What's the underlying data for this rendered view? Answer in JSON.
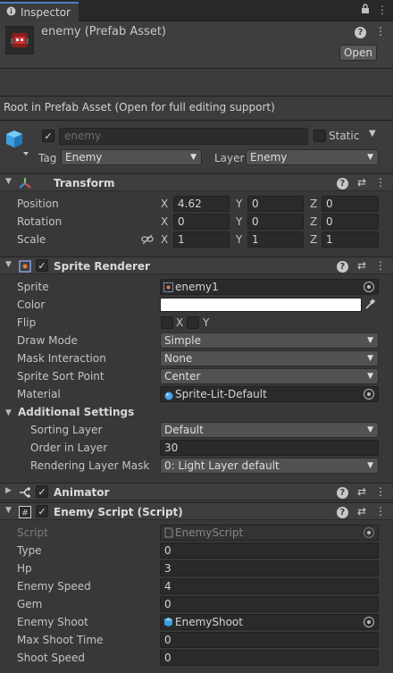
{
  "tab": {
    "title": "Inspector",
    "icon": "info-icon"
  },
  "header": {
    "asset_title": "enemy (Prefab Asset)",
    "open_label": "Open",
    "root_message": "Root in Prefab Asset (Open for full editing support)"
  },
  "gameobject": {
    "name": "enemy",
    "active": true,
    "static_label": "Static",
    "tag_label": "Tag",
    "tag_value": "Enemy",
    "layer_label": "Layer",
    "layer_value": "Enemy"
  },
  "transform": {
    "title": "Transform",
    "position_label": "Position",
    "rotation_label": "Rotation",
    "scale_label": "Scale",
    "position": {
      "x": "4.62",
      "y": "0",
      "z": "0"
    },
    "rotation": {
      "x": "0",
      "y": "0",
      "z": "0"
    },
    "scale": {
      "x": "1",
      "y": "1",
      "z": "1"
    },
    "axis_x": "X",
    "axis_y": "Y",
    "axis_z": "Z"
  },
  "sprite_renderer": {
    "title": "Sprite Renderer",
    "enabled": true,
    "sprite_label": "Sprite",
    "sprite_value": "enemy1",
    "color_label": "Color",
    "color_value": "#ffffff",
    "flip_label": "Flip",
    "flip_x": "X",
    "flip_y": "Y",
    "draw_mode_label": "Draw Mode",
    "draw_mode_value": "Simple",
    "mask_label": "Mask Interaction",
    "mask_value": "None",
    "sort_point_label": "Sprite Sort Point",
    "sort_point_value": "Center",
    "material_label": "Material",
    "material_value": "Sprite-Lit-Default",
    "additional_settings": "Additional Settings",
    "sorting_layer_label": "Sorting Layer",
    "sorting_layer_value": "Default",
    "order_label": "Order in Layer",
    "order_value": "30",
    "rendering_mask_label": "Rendering Layer Mask",
    "rendering_mask_value": "0: Light Layer default"
  },
  "animator": {
    "title": "Animator",
    "enabled": true
  },
  "enemy_script": {
    "title": "Enemy Script (Script)",
    "enabled": true,
    "script_label": "Script",
    "script_value": "EnemyScript",
    "type_label": "Type",
    "type_value": "0",
    "hp_label": "Hp",
    "hp_value": "3",
    "speed_label": "Enemy Speed",
    "speed_value": "4",
    "gem_label": "Gem",
    "gem_value": "0",
    "shoot_label": "Enemy Shoot",
    "shoot_value": "EnemyShoot",
    "max_shoot_label": "Max Shoot Time",
    "max_shoot_value": "0",
    "shoot_speed_label": "Shoot Speed",
    "shoot_speed_value": "0"
  }
}
